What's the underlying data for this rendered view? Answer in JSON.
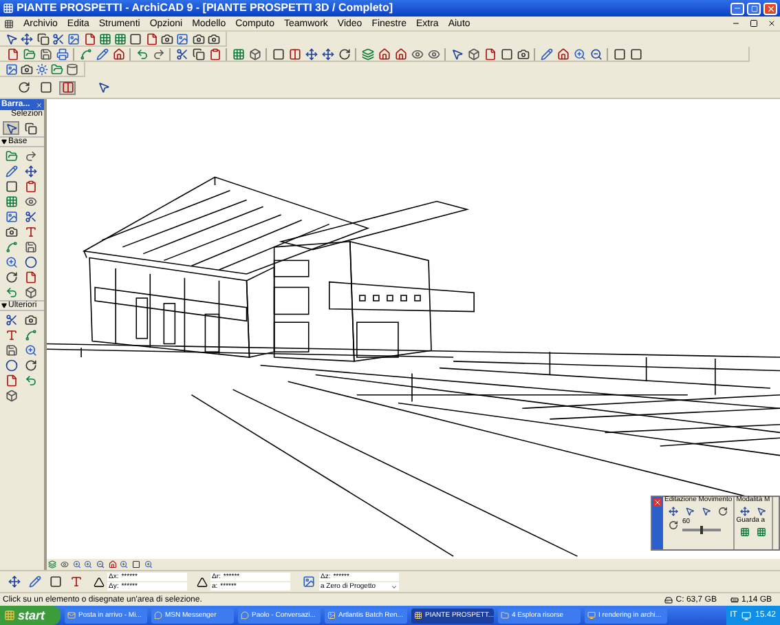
{
  "window": {
    "title": "PIANTE PROSPETTI - ArchiCAD 9 - [PIANTE PROSPETTI 3D / Completo]"
  },
  "menu": [
    "Archivio",
    "Edita",
    "Strumenti",
    "Opzioni",
    "Modello",
    "Computo",
    "Teamwork",
    "Video",
    "Finestre",
    "Extra",
    "Aiuto"
  ],
  "toolbox": {
    "title": "Barra...",
    "sections": [
      {
        "kind": "plain",
        "label": "Selezion"
      },
      {
        "kind": "header",
        "label": "Base"
      },
      {
        "kind": "header",
        "label": "Ulteriori"
      }
    ]
  },
  "info_box": {
    "groups": [
      {
        "kind": "xy",
        "fields": [
          {
            "label": "Δx:",
            "value": "******"
          },
          {
            "label": "Δy:",
            "value": "******"
          }
        ]
      },
      {
        "kind": "ra",
        "fields": [
          {
            "label": "Δr:",
            "value": "******"
          },
          {
            "label": "a:",
            "value": "******"
          }
        ]
      },
      {
        "kind": "z",
        "fields": [
          {
            "label": "Δz:",
            "value": "******"
          },
          {
            "label": "a Zero di Progetto"
          }
        ]
      }
    ]
  },
  "palette": {
    "sections": [
      {
        "title": "Editazione Movimento"
      },
      {
        "title": "Modalità M"
      }
    ],
    "reading": "60",
    "level": 0.5,
    "look_label": "Guarda a"
  },
  "status_bar": {
    "message": "Click su un elemento o disegnate un'area di selezione.",
    "disk": "C: 63,7 GB",
    "memory": "1,14 GB"
  },
  "taskbar": {
    "start": "start",
    "items": [
      {
        "label": "Posta in arrivo - Mi...",
        "selected": false
      },
      {
        "label": "MSN Messenger",
        "selected": false
      },
      {
        "label": "Paolo - Conversazi...",
        "selected": false
      },
      {
        "label": "Artlantis Batch Ren...",
        "selected": false
      },
      {
        "label": "PIANTE PROSPETT...",
        "selected": true
      },
      {
        "label": "4 Esplora risorse",
        "selected": false
      },
      {
        "label": "I rendering in archi...",
        "selected": false
      }
    ],
    "language": "IT",
    "clock": "15.42"
  }
}
